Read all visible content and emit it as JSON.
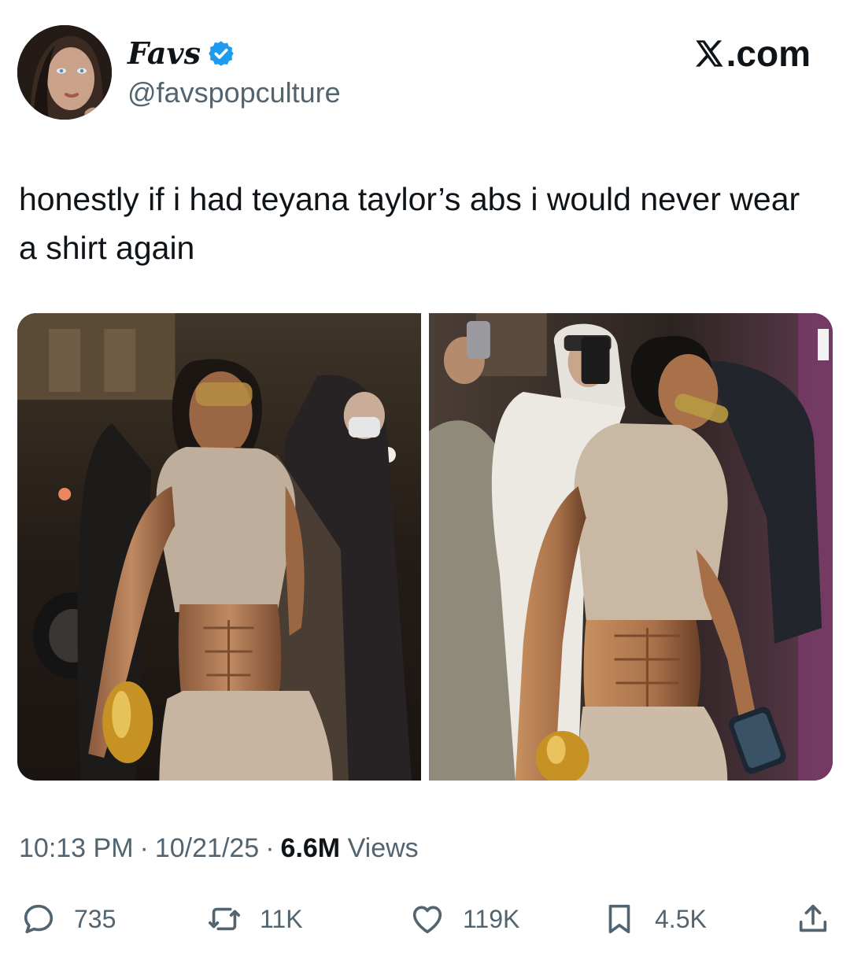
{
  "author": {
    "display_name": "Favs",
    "handle": "@favspopculture",
    "verified": true
  },
  "brand": {
    "label": ".com",
    "icon": "x-logo-icon"
  },
  "tweet": {
    "text": "honestly if i had teyana taylor’s abs i would never wear a shirt again"
  },
  "media": {
    "count": 2
  },
  "meta": {
    "time": "10:13 PM",
    "separator": "·",
    "date": "10/21/25",
    "views_count": "6.6M",
    "views_label": "Views"
  },
  "actions": {
    "replies": {
      "icon": "reply-icon",
      "count": "735"
    },
    "reposts": {
      "icon": "repost-icon",
      "count": "11K"
    },
    "likes": {
      "icon": "heart-icon",
      "count": "119K"
    },
    "bookmarks": {
      "icon": "bookmark-icon",
      "count": "4.5K"
    },
    "share": {
      "icon": "share-icon"
    }
  },
  "colors": {
    "text_primary": "#0f1419",
    "text_secondary": "#536471",
    "verified_blue": "#1d9bf0"
  }
}
